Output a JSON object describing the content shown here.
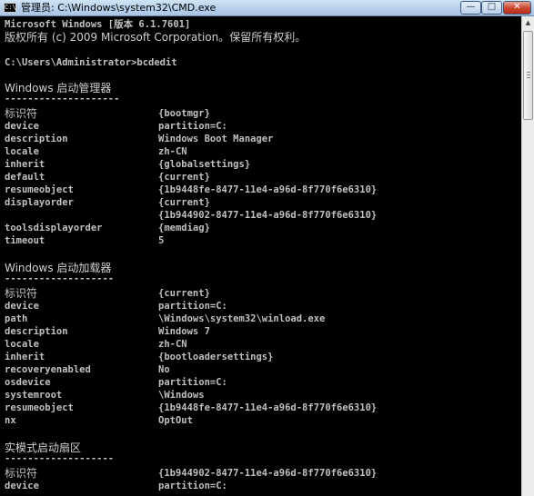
{
  "window": {
    "title": "管理员: C:\\Windows\\system32\\CMD.exe",
    "icon_text": "C:\\",
    "minimize": "—",
    "maximize": "□",
    "close": "✕"
  },
  "console": {
    "banner": "Microsoft Windows [版本 6.1.7601]",
    "copyright": "版权所有 (c) 2009 Microsoft Corporation。保留所有权利。",
    "prompt_line": "C:\\Users\\Administrator>bcdedit",
    "section1": {
      "heading": "Windows 启动管理器",
      "underline": "--------------------",
      "rows": [
        {
          "key": "标识符",
          "value": "{bootmgr}"
        },
        {
          "key": "device",
          "value": "partition=C:"
        },
        {
          "key": "description",
          "value": "Windows Boot Manager"
        },
        {
          "key": "locale",
          "value": "zh-CN"
        },
        {
          "key": "inherit",
          "value": "{globalsettings}"
        },
        {
          "key": "default",
          "value": "{current}"
        },
        {
          "key": "resumeobject",
          "value": "{1b9448fe-8477-11e4-a96d-8f770f6e6310}"
        },
        {
          "key": "displayorder",
          "value": "{current}"
        },
        {
          "key": "",
          "value": "{1b944902-8477-11e4-a96d-8f770f6e6310}"
        },
        {
          "key": "toolsdisplayorder",
          "value": "{memdiag}"
        },
        {
          "key": "timeout",
          "value": "5"
        }
      ]
    },
    "section2": {
      "heading": "Windows 启动加载器",
      "underline": "-------------------",
      "rows": [
        {
          "key": "标识符",
          "value": "{current}"
        },
        {
          "key": "device",
          "value": "partition=C:"
        },
        {
          "key": "path",
          "value": "\\Windows\\system32\\winload.exe"
        },
        {
          "key": "description",
          "value": "Windows 7"
        },
        {
          "key": "locale",
          "value": "zh-CN"
        },
        {
          "key": "inherit",
          "value": "{bootloadersettings}"
        },
        {
          "key": "recoveryenabled",
          "value": "No"
        },
        {
          "key": "osdevice",
          "value": "partition=C:"
        },
        {
          "key": "systemroot",
          "value": "\\Windows"
        },
        {
          "key": "resumeobject",
          "value": "{1b9448fe-8477-11e4-a96d-8f770f6e6310}"
        },
        {
          "key": "nx",
          "value": "OptOut"
        }
      ]
    },
    "section3": {
      "heading": "实模式启动扇区",
      "underline": "-------------------",
      "rows": [
        {
          "key": "标识符",
          "value": "{1b944902-8477-11e4-a96d-8f770f6e6310}"
        },
        {
          "key": "device",
          "value": "partition=C:"
        }
      ]
    }
  },
  "scrollbar": {
    "up_arrow": "▲"
  },
  "colors": {
    "console_bg": "#000000",
    "console_text": "#c0c0c0",
    "titlebar": "#b9d1ea",
    "close_button": "#c9452c"
  }
}
